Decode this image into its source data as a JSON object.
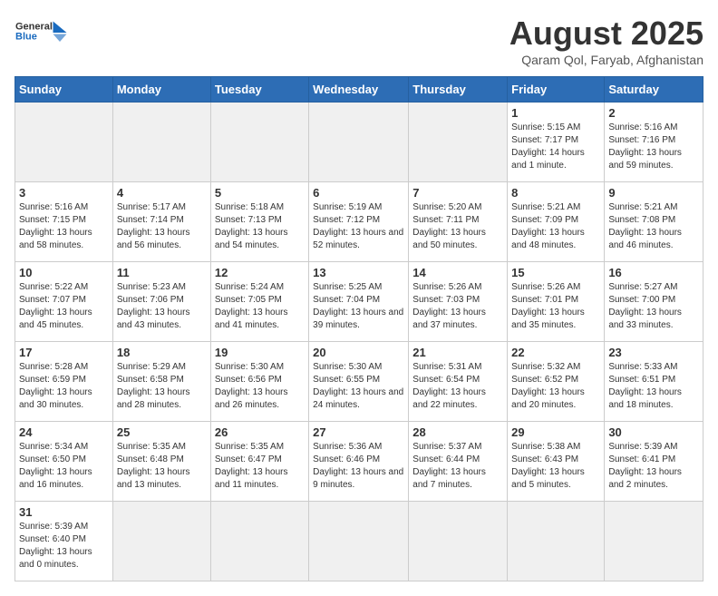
{
  "header": {
    "logo_general": "General",
    "logo_blue": "Blue",
    "month_title": "August 2025",
    "subtitle": "Qaram Qol, Faryab, Afghanistan"
  },
  "days_of_week": [
    "Sunday",
    "Monday",
    "Tuesday",
    "Wednesday",
    "Thursday",
    "Friday",
    "Saturday"
  ],
  "weeks": [
    [
      {
        "day": "",
        "info": ""
      },
      {
        "day": "",
        "info": ""
      },
      {
        "day": "",
        "info": ""
      },
      {
        "day": "",
        "info": ""
      },
      {
        "day": "",
        "info": ""
      },
      {
        "day": "1",
        "info": "Sunrise: 5:15 AM\nSunset: 7:17 PM\nDaylight: 14 hours and 1 minute."
      },
      {
        "day": "2",
        "info": "Sunrise: 5:16 AM\nSunset: 7:16 PM\nDaylight: 13 hours and 59 minutes."
      }
    ],
    [
      {
        "day": "3",
        "info": "Sunrise: 5:16 AM\nSunset: 7:15 PM\nDaylight: 13 hours and 58 minutes."
      },
      {
        "day": "4",
        "info": "Sunrise: 5:17 AM\nSunset: 7:14 PM\nDaylight: 13 hours and 56 minutes."
      },
      {
        "day": "5",
        "info": "Sunrise: 5:18 AM\nSunset: 7:13 PM\nDaylight: 13 hours and 54 minutes."
      },
      {
        "day": "6",
        "info": "Sunrise: 5:19 AM\nSunset: 7:12 PM\nDaylight: 13 hours and 52 minutes."
      },
      {
        "day": "7",
        "info": "Sunrise: 5:20 AM\nSunset: 7:11 PM\nDaylight: 13 hours and 50 minutes."
      },
      {
        "day": "8",
        "info": "Sunrise: 5:21 AM\nSunset: 7:09 PM\nDaylight: 13 hours and 48 minutes."
      },
      {
        "day": "9",
        "info": "Sunrise: 5:21 AM\nSunset: 7:08 PM\nDaylight: 13 hours and 46 minutes."
      }
    ],
    [
      {
        "day": "10",
        "info": "Sunrise: 5:22 AM\nSunset: 7:07 PM\nDaylight: 13 hours and 45 minutes."
      },
      {
        "day": "11",
        "info": "Sunrise: 5:23 AM\nSunset: 7:06 PM\nDaylight: 13 hours and 43 minutes."
      },
      {
        "day": "12",
        "info": "Sunrise: 5:24 AM\nSunset: 7:05 PM\nDaylight: 13 hours and 41 minutes."
      },
      {
        "day": "13",
        "info": "Sunrise: 5:25 AM\nSunset: 7:04 PM\nDaylight: 13 hours and 39 minutes."
      },
      {
        "day": "14",
        "info": "Sunrise: 5:26 AM\nSunset: 7:03 PM\nDaylight: 13 hours and 37 minutes."
      },
      {
        "day": "15",
        "info": "Sunrise: 5:26 AM\nSunset: 7:01 PM\nDaylight: 13 hours and 35 minutes."
      },
      {
        "day": "16",
        "info": "Sunrise: 5:27 AM\nSunset: 7:00 PM\nDaylight: 13 hours and 33 minutes."
      }
    ],
    [
      {
        "day": "17",
        "info": "Sunrise: 5:28 AM\nSunset: 6:59 PM\nDaylight: 13 hours and 30 minutes."
      },
      {
        "day": "18",
        "info": "Sunrise: 5:29 AM\nSunset: 6:58 PM\nDaylight: 13 hours and 28 minutes."
      },
      {
        "day": "19",
        "info": "Sunrise: 5:30 AM\nSunset: 6:56 PM\nDaylight: 13 hours and 26 minutes."
      },
      {
        "day": "20",
        "info": "Sunrise: 5:30 AM\nSunset: 6:55 PM\nDaylight: 13 hours and 24 minutes."
      },
      {
        "day": "21",
        "info": "Sunrise: 5:31 AM\nSunset: 6:54 PM\nDaylight: 13 hours and 22 minutes."
      },
      {
        "day": "22",
        "info": "Sunrise: 5:32 AM\nSunset: 6:52 PM\nDaylight: 13 hours and 20 minutes."
      },
      {
        "day": "23",
        "info": "Sunrise: 5:33 AM\nSunset: 6:51 PM\nDaylight: 13 hours and 18 minutes."
      }
    ],
    [
      {
        "day": "24",
        "info": "Sunrise: 5:34 AM\nSunset: 6:50 PM\nDaylight: 13 hours and 16 minutes."
      },
      {
        "day": "25",
        "info": "Sunrise: 5:35 AM\nSunset: 6:48 PM\nDaylight: 13 hours and 13 minutes."
      },
      {
        "day": "26",
        "info": "Sunrise: 5:35 AM\nSunset: 6:47 PM\nDaylight: 13 hours and 11 minutes."
      },
      {
        "day": "27",
        "info": "Sunrise: 5:36 AM\nSunset: 6:46 PM\nDaylight: 13 hours and 9 minutes."
      },
      {
        "day": "28",
        "info": "Sunrise: 5:37 AM\nSunset: 6:44 PM\nDaylight: 13 hours and 7 minutes."
      },
      {
        "day": "29",
        "info": "Sunrise: 5:38 AM\nSunset: 6:43 PM\nDaylight: 13 hours and 5 minutes."
      },
      {
        "day": "30",
        "info": "Sunrise: 5:39 AM\nSunset: 6:41 PM\nDaylight: 13 hours and 2 minutes."
      }
    ],
    [
      {
        "day": "31",
        "info": "Sunrise: 5:39 AM\nSunset: 6:40 PM\nDaylight: 13 hours and 0 minutes."
      },
      {
        "day": "",
        "info": ""
      },
      {
        "day": "",
        "info": ""
      },
      {
        "day": "",
        "info": ""
      },
      {
        "day": "",
        "info": ""
      },
      {
        "day": "",
        "info": ""
      },
      {
        "day": "",
        "info": ""
      }
    ]
  ]
}
